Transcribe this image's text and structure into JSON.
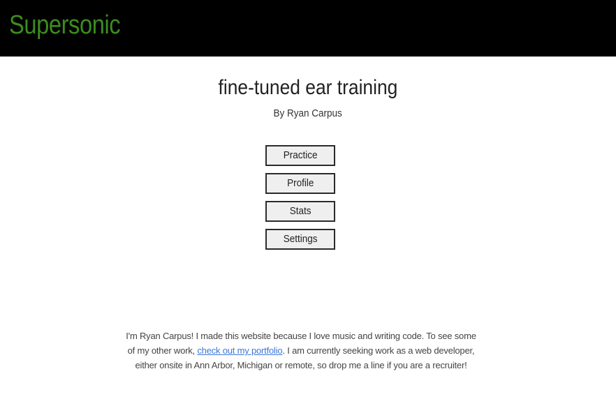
{
  "header": {
    "brand": "Supersonic",
    "background": "#000000",
    "brand_color": "#3c8c1e"
  },
  "main": {
    "title": "fine-tuned ear training",
    "byline": "By Ryan Carpus",
    "menu": [
      {
        "label": "Practice"
      },
      {
        "label": "Profile"
      },
      {
        "label": "Stats"
      },
      {
        "label": "Settings"
      }
    ]
  },
  "about": {
    "text_before_link": "I'm Ryan Carpus! I made this website because I love music and writing code. To see some of my other work, ",
    "link_text": "check out my portfolio",
    "text_after_link": ". I am currently seeking work as a web developer, either onsite in Ann Arbor, Michigan or remote, so drop me a line if you are a recruiter!",
    "link_color": "#3b78d8"
  }
}
